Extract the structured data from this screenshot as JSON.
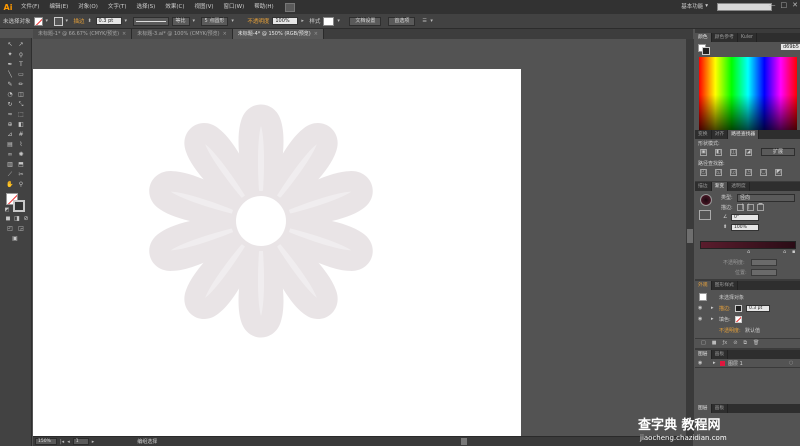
{
  "app": {
    "logo": "Ai",
    "title_state": "未选择对象"
  },
  "menu": [
    "文件(F)",
    "编辑(E)",
    "对象(O)",
    "文字(T)",
    "选择(S)",
    "效果(C)",
    "视图(V)",
    "窗口(W)",
    "帮助(H)"
  ],
  "workspace": {
    "label": "基本功能",
    "icon": "chevron-down-icon"
  },
  "window_controls": [
    "—",
    "□",
    "✕"
  ],
  "control_bar": {
    "selection": "未选择对象",
    "stroke_label": "描边",
    "stroke_value": "0.3 pt",
    "stroke_style": "等比",
    "brush": "5 点圆形",
    "opacity_label": "不透明度",
    "opacity_value": "100%",
    "style_label": "样式",
    "doc_setup": "文档设置",
    "prefs": "首选项"
  },
  "tabs": [
    {
      "label": "未标题-1* @ 66.67% (CMYK/预览)",
      "close": "×"
    },
    {
      "label": "未标题-3.ai* @ 100% (CMYK/预览)",
      "close": "×"
    },
    {
      "label": "未标题-4* @ 150% (RGB/预览)",
      "close": "×"
    }
  ],
  "status": {
    "zoom": "150%",
    "page": "1",
    "mode": "编组选择"
  },
  "panels": {
    "color_tabs": [
      "颜色",
      "颜色参考",
      "Kuler"
    ],
    "color_hex": "d69b5",
    "transform_tabs": [
      "变换",
      "对齐",
      "路径查找器"
    ],
    "shape_mode_label": "形状模式:",
    "pathfinder_label": "路径查找器:",
    "expand_button": "扩展",
    "gradient_tabs": [
      "描边",
      "渐变",
      "透明度"
    ],
    "gradient_type_label": "类型:",
    "gradient_type_value": "径向",
    "stroke_label": "描边:",
    "angle_value": "0°",
    "aspect_value": "100%",
    "opacity_label": "不透明度:",
    "location_label": "位置:",
    "appearance_tabs": [
      "外观",
      "图形样式"
    ],
    "appearance_title": "未选择对象",
    "appearance_stroke_label": "描边:",
    "appearance_stroke_value": "0.3 pt",
    "appearance_fill_label": "填色:",
    "appearance_opacity_label": "不透明度:",
    "appearance_opacity_value": "默认值",
    "layers_tabs": [
      "图层",
      "画板"
    ],
    "layer_name": "图层 1",
    "bottom_tabs": [
      "图层",
      "画板"
    ]
  },
  "watermark": {
    "main": "查字典 教程网",
    "sub": "jiaocheng.chazidian.com"
  },
  "colors": {
    "menu_bg": "#323232",
    "panel_bg": "#535353",
    "accent": "#e8a23a",
    "flower": "#e0163e",
    "gradient_dark": "#5a1d2d"
  }
}
